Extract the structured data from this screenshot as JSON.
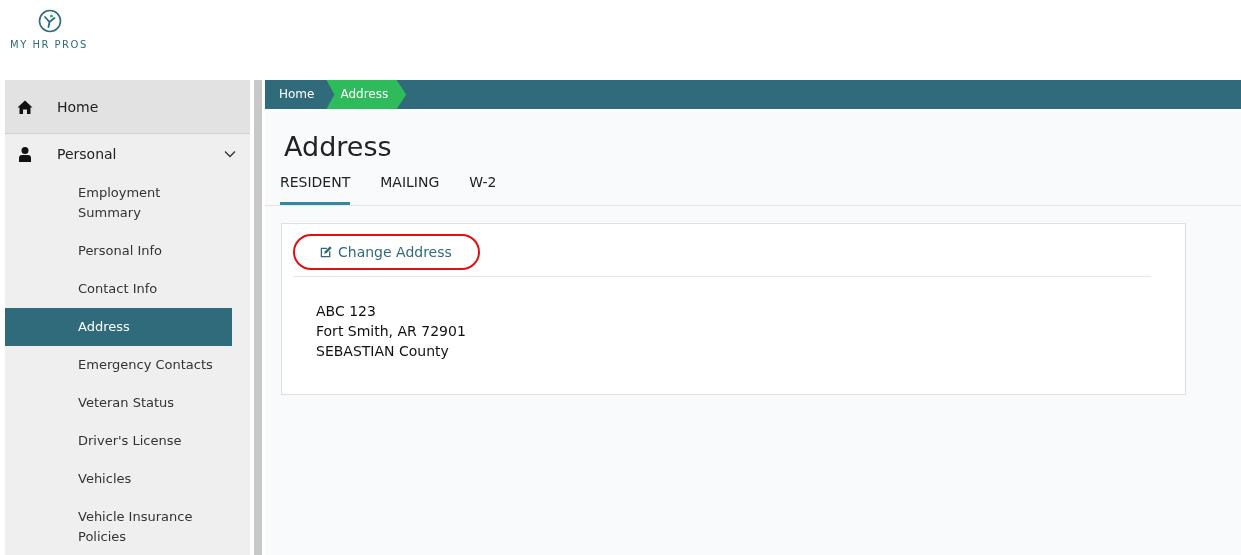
{
  "logo": {
    "text": "MY HR PROS"
  },
  "sidebar": {
    "items": [
      {
        "kind": "link",
        "label": "Home",
        "selected": false
      },
      {
        "kind": "group",
        "label": "Personal",
        "selected": false,
        "expanded": true,
        "children": [
          {
            "label": "Employment Summary",
            "selected": false
          },
          {
            "label": "Personal Info",
            "selected": false
          },
          {
            "label": "Contact Info",
            "selected": false
          },
          {
            "label": "Address",
            "selected": true
          },
          {
            "label": "Emergency Contacts",
            "selected": false
          },
          {
            "label": "Veteran Status",
            "selected": false
          },
          {
            "label": "Driver's License",
            "selected": false
          },
          {
            "label": "Vehicles",
            "selected": false
          },
          {
            "label": "Vehicle Insurance Policies",
            "selected": false
          }
        ]
      }
    ]
  },
  "breadcrumb": [
    {
      "label": "Home",
      "selected": false
    },
    {
      "label": "Address",
      "selected": true
    }
  ],
  "page_title": "Address",
  "tabs": [
    {
      "label": "RESIDENT",
      "selected": true
    },
    {
      "label": "MAILING",
      "selected": false
    },
    {
      "label": "W-2",
      "selected": false
    }
  ],
  "card": {
    "action": "Change Address",
    "action_highlighted": true,
    "address_lines": [
      "ABC 123",
      "Fort Smith, AR 72901",
      "SEBASTIAN County"
    ]
  }
}
